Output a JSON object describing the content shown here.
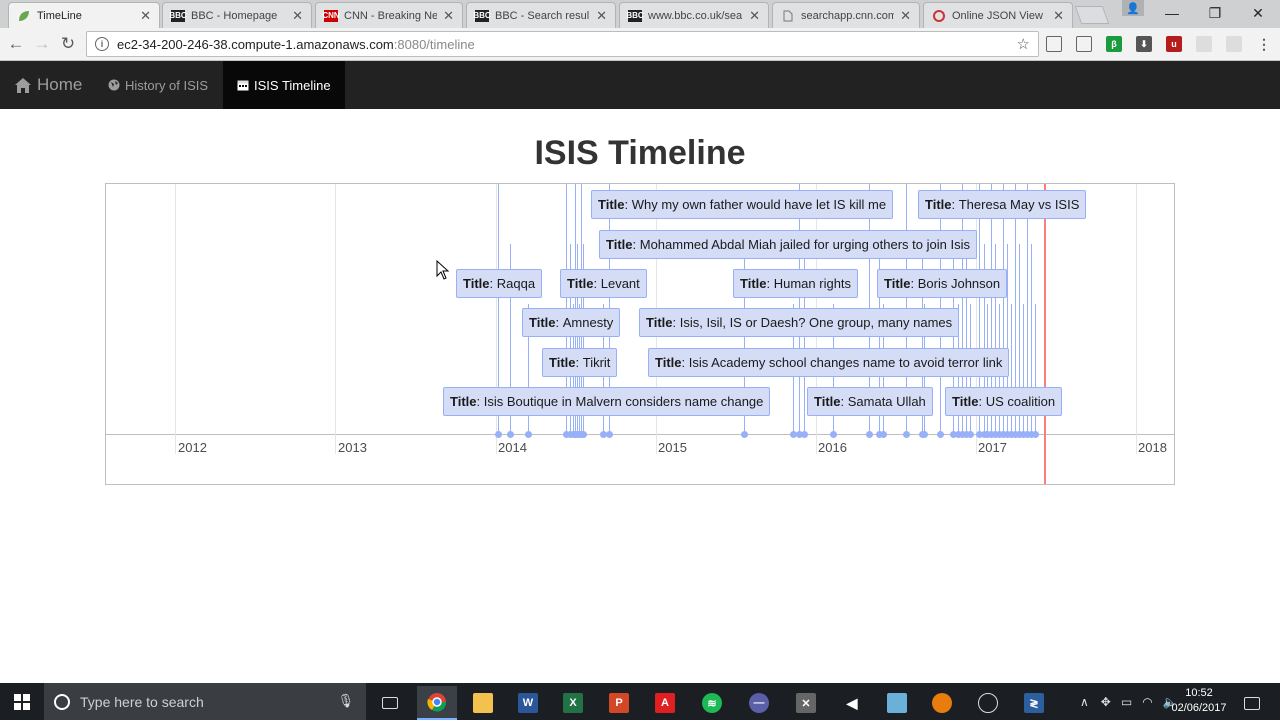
{
  "browser": {
    "tabs": [
      {
        "title": "TimeLine",
        "active": true,
        "favicon": "leaf-icon",
        "favicon_color": "#6aa84f"
      },
      {
        "title": "BBC - Homepage",
        "active": false,
        "favicon": "bbc-icon",
        "favicon_color": "#222222"
      },
      {
        "title": "CNN - Breaking Ne",
        "active": false,
        "favicon": "cnn-icon",
        "favicon_color": "#cc0000"
      },
      {
        "title": "BBC - Search resul",
        "active": false,
        "favicon": "bbc-icon",
        "favicon_color": "#222222"
      },
      {
        "title": "www.bbc.co.uk/sea",
        "active": false,
        "favicon": "bbc-icon",
        "favicon_color": "#222222"
      },
      {
        "title": "searchapp.cnn.com",
        "active": false,
        "favicon": "page-icon",
        "favicon_color": "#888888"
      },
      {
        "title": "Online JSON View",
        "active": false,
        "favicon": "json-icon",
        "favicon_color": "#cc3333"
      }
    ],
    "url_host": "ec2-34-200-246-38.compute-1.amazonaws.com",
    "url_path": ":8080/timeline"
  },
  "navbar": {
    "brand": "Home",
    "items": [
      {
        "label": "History of ISIS",
        "icon": "globe-icon",
        "active": false
      },
      {
        "label": "ISIS Timeline",
        "icon": "calendar-icon",
        "active": true
      }
    ]
  },
  "page": {
    "title": "ISIS Timeline"
  },
  "timeline": {
    "years": [
      "2012",
      "2013",
      "2014",
      "2015",
      "2016",
      "2017",
      "2018"
    ],
    "event_prefix": "Title",
    "events": [
      {
        "title": "Why my own father would have let IS kill me"
      },
      {
        "title": "Theresa May vs ISIS"
      },
      {
        "title": "Mohammed Abdal Miah jailed for urging others to join Isis"
      },
      {
        "title": "Raqqa"
      },
      {
        "title": "Levant"
      },
      {
        "title": "Human rights"
      },
      {
        "title": "Boris Johnson"
      },
      {
        "title": "Amnesty"
      },
      {
        "title": "Isis, Isil, IS or Daesh? One group, many names"
      },
      {
        "title": "Tikrit"
      },
      {
        "title": "Isis Academy school changes name to avoid terror link"
      },
      {
        "title": "Isis Boutique in Malvern considers name change"
      },
      {
        "title": "Samata Ullah"
      },
      {
        "title": "US coalition"
      }
    ]
  },
  "taskbar": {
    "search_placeholder": "Type here to search",
    "time": "10:52",
    "date": "02/06/2017"
  }
}
